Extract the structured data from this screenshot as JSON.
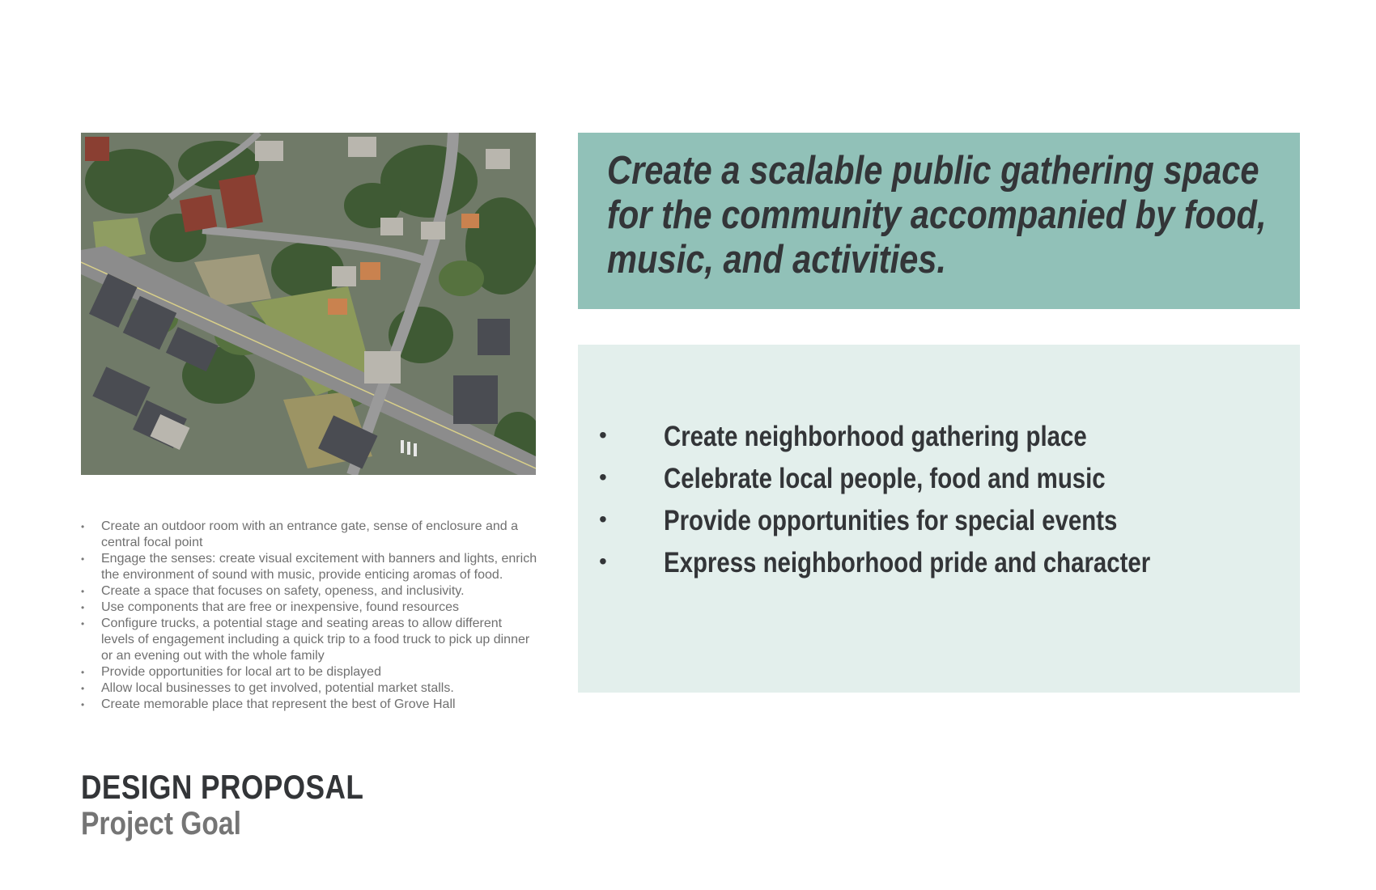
{
  "goal_panel": {
    "text": "Create a scalable public gathering space for the community accompanied by food, music, and activities."
  },
  "key_points": [
    "Create neighborhood gathering place",
    "Celebrate local people, food and music",
    "Provide opportunities for special events",
    "Express neighborhood pride and character"
  ],
  "details": [
    "Create an outdoor room with an entrance gate, sense of enclosure and a central focal point",
    "Engage the senses: create visual excitement with banners and lights, enrich the environment of sound with music, provide enticing aromas of food.",
    "Create a space that focuses on safety, openess, and inclusivity.",
    "Use components that are free or inexpensive, found resources",
    "Configure trucks, a potential stage and seating areas to allow different levels of engagement including a quick trip to a food truck to pick up dinner or an evening out with the whole family",
    "Provide opportunities for local art to be displayed",
    "Allow local businesses to get involved, potential market stalls.",
    "Create memorable place that represent the best of Grove Hall"
  ],
  "heading": {
    "title": "DESIGN PROPOSAL",
    "subtitle": "Project Goal"
  },
  "colors": {
    "goal_panel_bg": "#91c1b8",
    "points_panel_bg": "#e3efec",
    "dark_text": "#333538",
    "gray_text": "#707070"
  }
}
